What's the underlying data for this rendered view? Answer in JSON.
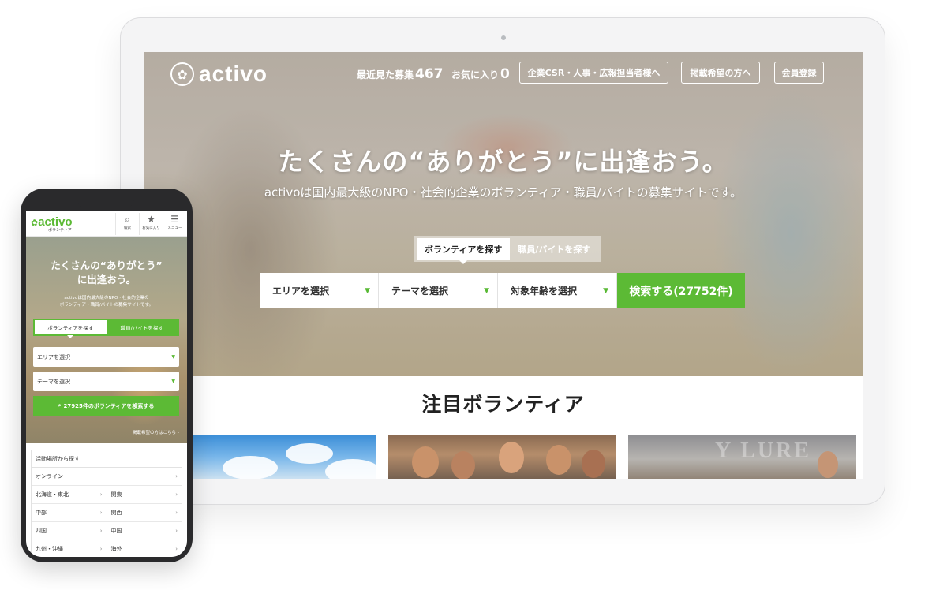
{
  "desktop": {
    "brand": "activo",
    "header": {
      "recent_label": "最近見た募集",
      "recent_count": "467",
      "favorites_label": "お気に入り",
      "favorites_count": "0",
      "csr_button": "企業CSR・人事・広報担当者様へ",
      "listing_button": "掲載希望の方へ",
      "register_button": "会員登録"
    },
    "hero": {
      "title": "たくさんの“ありがとう”に出逢おう。",
      "subtitle": "activoは国内最大級のNPO・社会的企業のボランティア・職員/バイトの募集サイトです。"
    },
    "search": {
      "tabs": [
        "ボランティアを探す",
        "職員/バイトを探す"
      ],
      "active_tab": 0,
      "selects": [
        "エリアを選択",
        "テーマを選択",
        "対象年齢を選択"
      ],
      "button": "検索する(27752件)"
    },
    "featured": {
      "title": "注目ボランティア",
      "card3_text": "Y LURE"
    }
  },
  "mobile": {
    "brand": "activo",
    "brand_sub": "ボランティア",
    "icons": [
      {
        "icon": "search-icon",
        "label": "検索"
      },
      {
        "icon": "star-icon",
        "label": "お気に入り"
      },
      {
        "icon": "menu-icon",
        "label": "メニュー"
      }
    ],
    "hero": {
      "title_line1": "たくさんの“ありがとう”",
      "title_line2": "に出逢おう。",
      "desc_line1": "activoは国内最大級のNPO・社会的企業の",
      "desc_line2": "ボランティア・職員/バイトの募集サイトです。"
    },
    "tabs": [
      "ボランティアを探す",
      "職員/バイトを探す"
    ],
    "selects": [
      "エリアを選択",
      "テーマを選択"
    ],
    "search_button": "27925件のボランティアを検索する",
    "listing_link": "掲載希望の方はこちら ›",
    "areas": {
      "header": "活動場所から探す",
      "online": "オンライン",
      "rows": [
        [
          "北海道・東北",
          "関東"
        ],
        [
          "中部",
          "関西"
        ],
        [
          "四国",
          "中国"
        ],
        [
          "九州・沖縄",
          "海外"
        ]
      ]
    }
  },
  "colors": {
    "accent": "#5cba35",
    "phone_body": "#2a2a2c",
    "laptop_body": "#f4f4f5"
  }
}
